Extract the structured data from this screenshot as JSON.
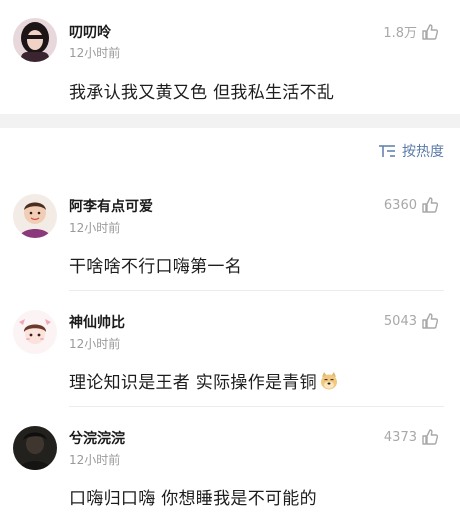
{
  "comments": [
    {
      "name": "叨叨呤",
      "time": "12小时前",
      "likes": "1.8万",
      "text": "我承认我又黄又色 但我私生活不乱",
      "avatar_icon": "girl-avatar"
    },
    {
      "name": "阿李有点可爱",
      "time": "12小时前",
      "likes": "6360",
      "text": "干啥啥不行口嗨第一名",
      "avatar_icon": "toddler-avatar"
    },
    {
      "name": "神仙帅比",
      "time": "12小时前",
      "likes": "5043",
      "text": "理论知识是王者 实际操作是青铜",
      "avatar_icon": "cartoon-avatar",
      "emoji": "doge-emoji"
    },
    {
      "name": "兮浣浣浣",
      "time": "12小时前",
      "likes": "4373",
      "text": "口嗨归口嗨 你想睡我是不可能的",
      "avatar_icon": "dark-portrait-avatar"
    }
  ],
  "sort": {
    "label": "按热度",
    "icon": "sort-icon"
  },
  "colors": {
    "accent": "#5b7ca8",
    "muted": "#9a9a9a",
    "band": "#f2f2f2"
  }
}
